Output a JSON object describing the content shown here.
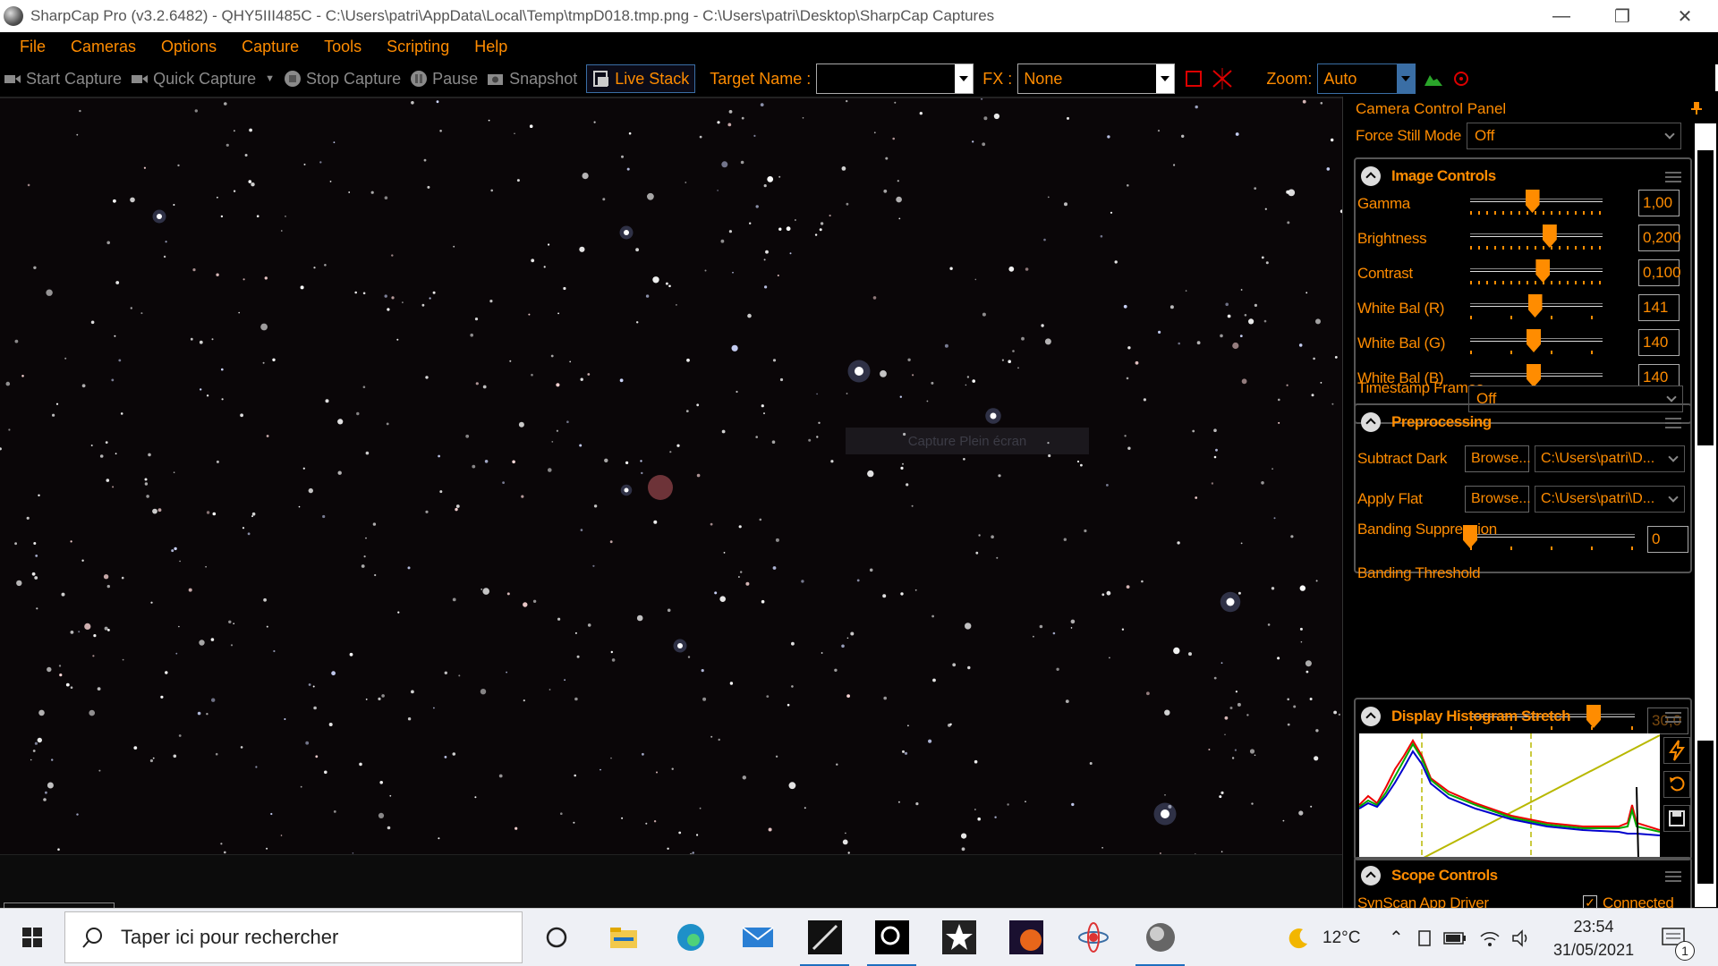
{
  "window": {
    "title": "SharpCap Pro (v3.2.6482) - QHY5III485C - C:\\Users\\patri\\AppData\\Local\\Temp\\tmpD018.tmp.png - C:\\Users\\patri\\Desktop\\SharpCap Captures",
    "controls": [
      "minimize-icon",
      "restore-icon",
      "close-icon"
    ]
  },
  "menu": [
    "File",
    "Cameras",
    "Options",
    "Capture",
    "Tools",
    "Scripting",
    "Help"
  ],
  "toolbar": {
    "start_capture": "Start Capture",
    "quick_capture": "Quick Capture",
    "stop_capture": "Stop Capture",
    "pause": "Pause",
    "snapshot": "Snapshot",
    "live_stack": "Live Stack",
    "target_name_label": "Target Name :",
    "target_name_value": "",
    "fx_label": "FX :",
    "fx_value": "None",
    "zoom_label": "Zoom:",
    "zoom_value": "Auto"
  },
  "viewer": {
    "overlay_hint": "Capture Plein écran"
  },
  "panel": {
    "title": "Camera Control Panel",
    "force_still_label": "Force Still Mode",
    "force_still_value": "Off",
    "image_controls": {
      "title": "Image Controls",
      "rows": [
        {
          "label": "Gamma",
          "value": "1,00",
          "level": 0.47
        },
        {
          "label": "Brightness",
          "value": "0,200",
          "level": 0.6
        },
        {
          "label": "Contrast",
          "value": "0,100",
          "level": 0.55
        },
        {
          "label": "White Bal (R)",
          "value": "141",
          "level": 0.49
        },
        {
          "label": "White Bal (G)",
          "value": "140",
          "level": 0.48
        },
        {
          "label": "White Bal (B)",
          "value": "140",
          "level": 0.48
        }
      ],
      "timestamp_label": "Timestamp Frames",
      "timestamp_value": "Off"
    },
    "preprocessing": {
      "title": "Preprocessing",
      "subtract_dark_label": "Subtract Dark",
      "apply_flat_label": "Apply Flat",
      "browse_label": "Browse...",
      "dark_path": "C:\\Users\\patri\\D...",
      "flat_path": "C:\\Users\\patri\\D...",
      "banding_suppression_label": "Banding Suppression",
      "banding_suppression_value": "0",
      "banding_suppression_level": 0.0,
      "banding_threshold_label": "Banding Threshold",
      "banding_threshold_value": "30,0",
      "banding_threshold_level": 0.75
    },
    "histogram": {
      "title": "Display Histogram Stretch",
      "side_icons": [
        "lightning-icon",
        "reset-icon",
        "save-icon"
      ]
    },
    "scope": {
      "title": "Scope Controls",
      "driver": "SynScan App Driver",
      "connected_label": "Connected",
      "connected": true
    }
  },
  "taskbar": {
    "search_placeholder": "Taper ici pour rechercher",
    "temperature": "12°C",
    "time": "23:54",
    "date": "31/05/2021",
    "notification_count": "1",
    "apps": [
      "cortana-icon",
      "file-explorer-icon",
      "edge-icon",
      "mail-icon",
      "app-comet-icon",
      "app-pro-icon",
      "app-star-icon",
      "app-planet-icon",
      "app-molecule-icon",
      "sharpcap-icon"
    ]
  },
  "colors": {
    "accent": "#ff8c00",
    "panel_bg": "#000000",
    "taskbar_bg": "#eef0f5"
  }
}
